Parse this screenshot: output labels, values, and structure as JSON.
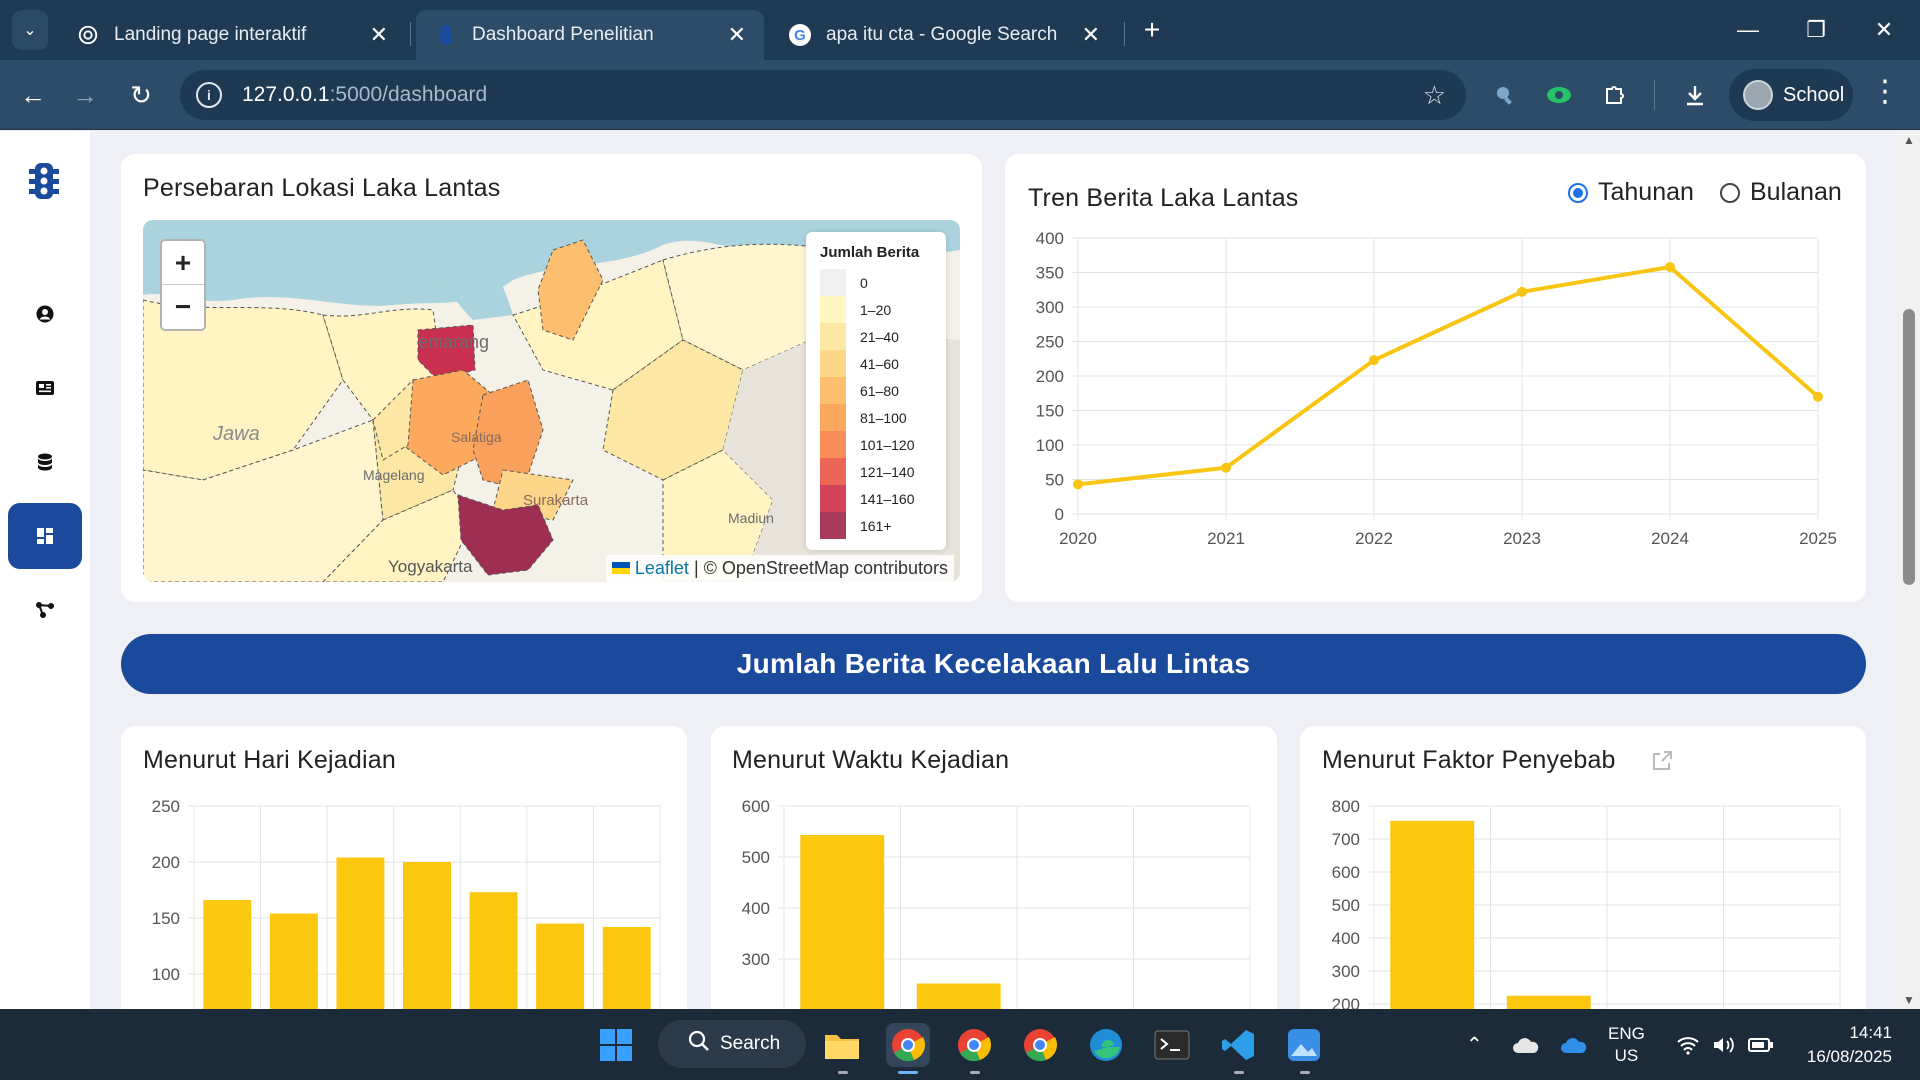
{
  "browser": {
    "tabs": [
      {
        "title": "Landing page interaktif",
        "icon": "chatgpt-icon",
        "active": false
      },
      {
        "title": "Dashboard Penelitian",
        "icon": "page-icon",
        "active": true
      },
      {
        "title": "apa itu cta - Google Search",
        "icon": "google-icon",
        "active": false
      }
    ],
    "url_host": "127.0.0.1",
    "url_path": ":5000/dashboard",
    "profile_name": "School"
  },
  "sidebar": {
    "items": [
      {
        "name": "traffic-light-logo",
        "active": false
      },
      {
        "name": "user-icon",
        "active": false
      },
      {
        "name": "news-icon",
        "active": false
      },
      {
        "name": "database-icon",
        "active": false
      },
      {
        "name": "dashboard-icon",
        "active": true
      },
      {
        "name": "network-icon",
        "active": false
      }
    ]
  },
  "map_card": {
    "title": "Persebaran Lokasi Laka Lantas",
    "legend_title": "Jumlah Berita",
    "legend": [
      {
        "label": "0",
        "color": "#f0f0f0"
      },
      {
        "label": "1–20",
        "color": "#fff7c2"
      },
      {
        "label": "21–40",
        "color": "#fde7a4"
      },
      {
        "label": "41–60",
        "color": "#fdd68a"
      },
      {
        "label": "61–80",
        "color": "#fdbf6f"
      },
      {
        "label": "81–100",
        "color": "#fca95e"
      },
      {
        "label": "101–120",
        "color": "#f88d5a"
      },
      {
        "label": "121–140",
        "color": "#ec6658"
      },
      {
        "label": "141–160",
        "color": "#d3435a"
      },
      {
        "label": "161+",
        "color": "#a83a5a"
      }
    ],
    "map_labels": [
      "emarang",
      "Jawa",
      "Magelang",
      "Salatiga",
      "Surakarta",
      "Madiun",
      "Yogyakarta"
    ],
    "zoom_in": "+",
    "zoom_out": "−",
    "attribution_link": "Leaflet",
    "attribution_text": "| © OpenStreetMap contributors"
  },
  "trend_card": {
    "title": "Tren Berita Laka Lantas",
    "radio_yearly": "Tahunan",
    "radio_monthly": "Bulanan",
    "selected": "Tahunan"
  },
  "banner": {
    "text": "Jumlah Berita Kecelakaan Lalu Lintas"
  },
  "day_card": {
    "title": "Menurut Hari Kejadian"
  },
  "time_card": {
    "title": "Menurut Waktu Kejadian"
  },
  "factor_card": {
    "title": "Menurut Faktor Penyebab"
  },
  "chart_data": [
    {
      "id": "trend",
      "type": "line",
      "x": [
        "2020",
        "2021",
        "2022",
        "2023",
        "2024",
        "2025"
      ],
      "series": [
        {
          "values": [
            43,
            67,
            223,
            322,
            358,
            170
          ],
          "color": "#f9c513"
        }
      ],
      "ylim": [
        0,
        400
      ],
      "yticks": [
        0,
        50,
        100,
        150,
        200,
        250,
        300,
        350,
        400
      ],
      "grid": true
    },
    {
      "id": "day",
      "type": "bar",
      "categories": [
        "",
        "",
        "",
        "",
        "",
        "",
        ""
      ],
      "values": [
        166,
        154,
        204,
        200,
        173,
        145,
        142
      ],
      "ylim": [
        100,
        250
      ],
      "yticks": [
        100,
        150,
        200,
        250
      ],
      "color": "#fcc70f"
    },
    {
      "id": "time",
      "type": "bar",
      "categories": [
        "",
        "",
        "",
        ""
      ],
      "values": [
        543,
        252,
        0,
        0
      ],
      "ylim": [
        200,
        600
      ],
      "yticks": [
        200,
        300,
        400,
        500,
        600
      ],
      "color": "#fcc70f"
    },
    {
      "id": "factor",
      "type": "bar",
      "categories": [
        "",
        "",
        "",
        ""
      ],
      "values": [
        755,
        225,
        0,
        0
      ],
      "ylim": [
        200,
        800
      ],
      "yticks": [
        200,
        300,
        400,
        500,
        600,
        700,
        800
      ],
      "color": "#fcc70f"
    }
  ],
  "taskbar": {
    "search_label": "Search",
    "lang_top": "ENG",
    "lang_bottom": "US",
    "time": "14:41",
    "date": "16/08/2025"
  }
}
